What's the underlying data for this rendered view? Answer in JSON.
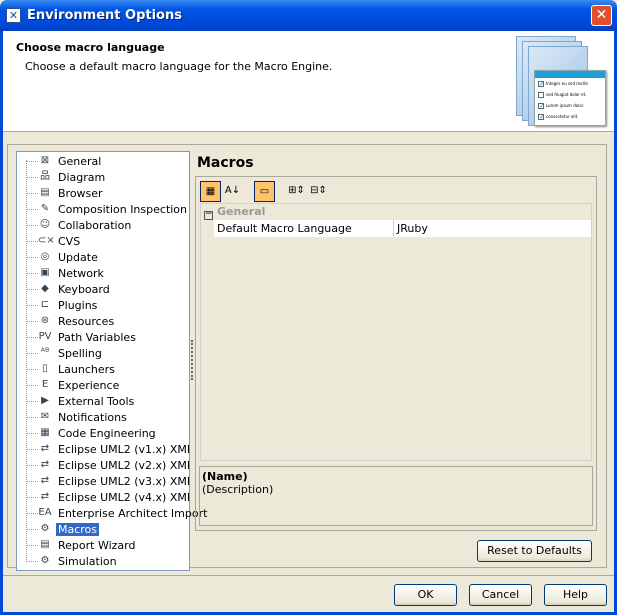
{
  "window": {
    "title": "Environment Options",
    "close": "✕"
  },
  "header": {
    "title": "Choose macro language",
    "description": "Choose a default macro language for the Macro Engine.",
    "image_rows": [
      "Integer eu sed mollis",
      "sed feugiat dolor et.",
      "Lorem ipsum dolor",
      "consectetur elit."
    ]
  },
  "tree": {
    "selected": "Macros",
    "items": [
      {
        "label": "General",
        "icon": "⊠"
      },
      {
        "label": "Diagram",
        "icon": "品"
      },
      {
        "label": "Browser",
        "icon": "▤"
      },
      {
        "label": "Composition Inspection",
        "icon": "✎"
      },
      {
        "label": "Collaboration",
        "icon": "☺"
      },
      {
        "label": "CVS",
        "icon": "⊂×"
      },
      {
        "label": "Update",
        "icon": "◎"
      },
      {
        "label": "Network",
        "icon": "▣"
      },
      {
        "label": "Keyboard",
        "icon": "◆"
      },
      {
        "label": "Plugins",
        "icon": "⊏"
      },
      {
        "label": "Resources",
        "icon": "⊛"
      },
      {
        "label": "Path Variables",
        "icon": "PV"
      },
      {
        "label": "Spelling",
        "icon": "ᴬᴮ"
      },
      {
        "label": "Launchers",
        "icon": "▯"
      },
      {
        "label": "Experience",
        "icon": "E"
      },
      {
        "label": "External Tools",
        "icon": "▶"
      },
      {
        "label": "Notifications",
        "icon": "✉"
      },
      {
        "label": "Code Engineering",
        "icon": "▦"
      },
      {
        "label": "Eclipse UML2 (v1.x) XMI",
        "icon": "⇄"
      },
      {
        "label": "Eclipse UML2 (v2.x) XMI",
        "icon": "⇄"
      },
      {
        "label": "Eclipse UML2 (v3.x) XMI",
        "icon": "⇄"
      },
      {
        "label": "Eclipse UML2 (v4.x) XMI",
        "icon": "⇄"
      },
      {
        "label": "Enterprise Architect Import",
        "icon": "EA"
      },
      {
        "label": "Macros",
        "icon": "⚙"
      },
      {
        "label": "Report Wizard",
        "icon": "▤"
      },
      {
        "label": "Simulation",
        "icon": "⚙"
      }
    ]
  },
  "panel": {
    "title": "Macros",
    "category": "General",
    "property": {
      "name": "Default Macro Language",
      "value": "JRuby"
    },
    "desc_name": "(Name)",
    "desc_text": "(Description)",
    "reset": "Reset to Defaults"
  },
  "buttons": {
    "ok": "OK",
    "cancel": "Cancel",
    "help": "Help"
  }
}
